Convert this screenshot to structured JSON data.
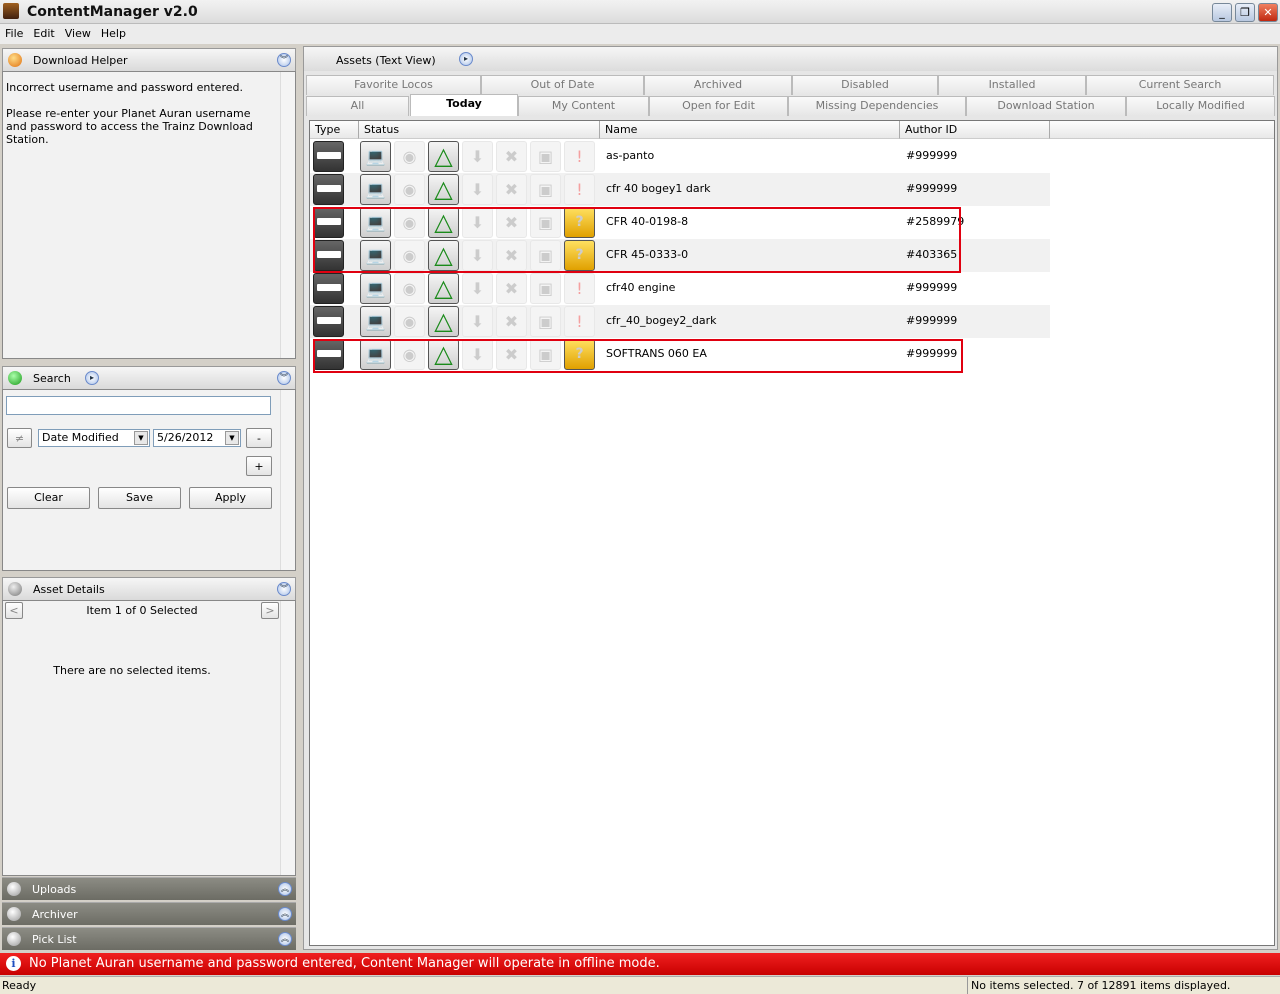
{
  "window": {
    "title": "ContentManager v2.0"
  },
  "menu": [
    "File",
    "Edit",
    "View",
    "Help"
  ],
  "download_helper": {
    "title": "Download Helper",
    "line1": "Incorrect username and password entered.",
    "line2": "Please re-enter your Planet Auran username and password to access the Trainz Download Station."
  },
  "search": {
    "title": "Search",
    "input_value": "",
    "field": "Date Modified",
    "date": "5/26/2012",
    "minus": "-",
    "plus": "+",
    "clear": "Clear",
    "save": "Save",
    "apply": "Apply",
    "not_equal": "≠"
  },
  "asset_details": {
    "title": "Asset Details",
    "nav": "Item 1 of 0 Selected",
    "empty": "There are no selected items.",
    "prev": "<",
    "next": ">"
  },
  "collapsed_panels": [
    "Uploads",
    "Archiver",
    "Pick List"
  ],
  "assets": {
    "title": "Assets (Text View)",
    "tabs_row1": [
      "Favorite Locos",
      "Out of Date",
      "Archived",
      "Disabled",
      "Installed",
      "Current Search"
    ],
    "tabs_row2": [
      "All",
      "Today",
      "My Content",
      "Open for Edit",
      "Missing Dependencies",
      "Download Station",
      "Locally Modified"
    ],
    "active_tab": "Today",
    "columns": [
      "Type",
      "Status",
      "Name",
      "Author ID"
    ],
    "rows": [
      {
        "name": "as-panto",
        "author": "#999999",
        "missing": false,
        "highlight": false
      },
      {
        "name": "cfr 40 bogey1 dark",
        "author": "#999999",
        "missing": false,
        "highlight": false
      },
      {
        "name": "CFR 40-0198-8",
        "author": "#2589979",
        "missing": true,
        "highlight": true
      },
      {
        "name": "CFR 45-0333-0",
        "author": "#403365",
        "missing": true,
        "highlight": true
      },
      {
        "name": "cfr40 engine",
        "author": "#999999",
        "missing": false,
        "highlight": false
      },
      {
        "name": "cfr_40_bogey2_dark",
        "author": "#999999",
        "missing": false,
        "highlight": false
      },
      {
        "name": "SOFTRANS 060 EA",
        "author": "#999999",
        "missing": true,
        "highlight": true
      }
    ]
  },
  "notification": "No Planet Auran username and password entered, Content Manager will operate in offline mode.",
  "status": {
    "left": "Ready",
    "right": "No items selected. 7 of 12891 items displayed."
  }
}
